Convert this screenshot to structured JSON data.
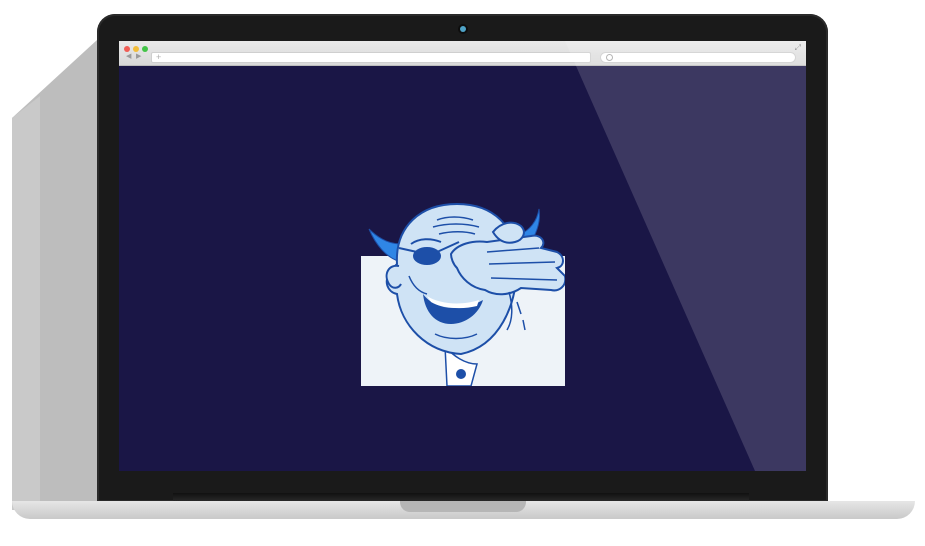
{
  "browser": {
    "back_glyph": "◀",
    "forward_glyph": "▶",
    "new_tab_glyph": "+",
    "expand_glyph": "⤢",
    "url_value": "",
    "search_value": ""
  },
  "colors": {
    "page_background": "#1a1646",
    "bezel": "#1a1a1a",
    "artwork_background": "#eef3f8",
    "artwork_line": "#1d4fa8",
    "artwork_skin": "#cfe3f5",
    "artwork_horns": "#2f86e6"
  },
  "icons": [
    "close-dot",
    "minimize-dot",
    "zoom-dot",
    "back-arrow-icon",
    "forward-arrow-icon",
    "new-tab-icon",
    "search-icon",
    "expand-icon",
    "camera-icon"
  ],
  "content": {
    "image_subject": "cartoon-laughing-bald-man-with-eyepatch-hand-over-eye"
  }
}
